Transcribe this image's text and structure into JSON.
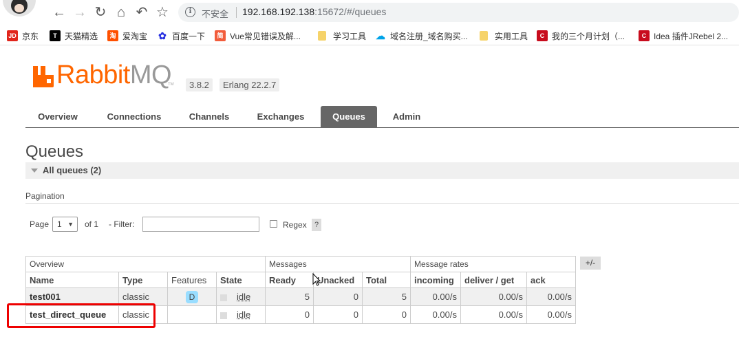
{
  "browser": {
    "insecure_label": "不安全",
    "url_host": "192.168.192.138",
    "url_rest": ":15672/#/queues"
  },
  "bookmarks": [
    {
      "label": "京东",
      "icon": "jd-icon",
      "color": "#e1251b",
      "glyph": "JD"
    },
    {
      "label": "天猫精选",
      "icon": "tmall-icon",
      "color": "#000000",
      "glyph": "T"
    },
    {
      "label": "爱淘宝",
      "icon": "taobao-icon",
      "color": "#ff5000",
      "glyph": "淘"
    },
    {
      "label": "百度一下",
      "icon": "baidu-paw-icon",
      "color": "#2932e1",
      "glyph": "✿"
    },
    {
      "label": "Vue常见错误及解...",
      "icon": "bookmark-page-icon",
      "color": "#f25c3b",
      "glyph": "简"
    },
    {
      "label": "学习工具",
      "icon": "folder-icon",
      "color": "#f6d36a",
      "glyph": ""
    },
    {
      "label": "域名注册_域名购买...",
      "icon": "cloud-icon",
      "color": "#00a3e8",
      "glyph": "☁"
    },
    {
      "label": "实用工具",
      "icon": "folder-icon",
      "color": "#f6d36a",
      "glyph": ""
    },
    {
      "label": "我的三个月计划（...",
      "icon": "csdn-icon",
      "color": "#c80c1d",
      "glyph": "C"
    },
    {
      "label": "Idea 插件JRebel 2...",
      "icon": "csdn-icon",
      "color": "#c80c1d",
      "glyph": "C"
    }
  ],
  "header": {
    "logo_rabbit": "Rabbit",
    "logo_mq": "MQ",
    "logo_tm": "TM",
    "version": "3.8.2",
    "erlang": "Erlang 22.2.7"
  },
  "tabs": [
    {
      "label": "Overview",
      "active": false
    },
    {
      "label": "Connections",
      "active": false
    },
    {
      "label": "Channels",
      "active": false
    },
    {
      "label": "Exchanges",
      "active": false
    },
    {
      "label": "Queues",
      "active": true
    },
    {
      "label": "Admin",
      "active": false
    }
  ],
  "page": {
    "title": "Queues",
    "section": "All queues (2)",
    "pagination_heading": "Pagination"
  },
  "pagination": {
    "page_label": "Page",
    "page_value": "1",
    "of_label": "of 1",
    "filter_label": "- Filter:",
    "filter_value": "",
    "regex_label": "Regex",
    "help_label": "?"
  },
  "table": {
    "groups": [
      "Overview",
      "Messages",
      "Message rates"
    ],
    "columns": [
      "Name",
      "Type",
      "Features",
      "State",
      "Ready",
      "Unacked",
      "Total",
      "incoming",
      "deliver / get",
      "ack"
    ],
    "plus_minus": "+/-",
    "rows": [
      {
        "name": "test001",
        "type": "classic",
        "feature": "D",
        "state": "idle",
        "ready": "5",
        "unacked": "0",
        "total": "5",
        "incoming": "0.00/s",
        "deliver_get": "0.00/s",
        "ack": "0.00/s"
      },
      {
        "name": "test_direct_queue",
        "type": "classic",
        "feature": "",
        "state": "idle",
        "ready": "0",
        "unacked": "0",
        "total": "0",
        "incoming": "0.00/s",
        "deliver_get": "0.00/s",
        "ack": "0.00/s"
      }
    ]
  }
}
